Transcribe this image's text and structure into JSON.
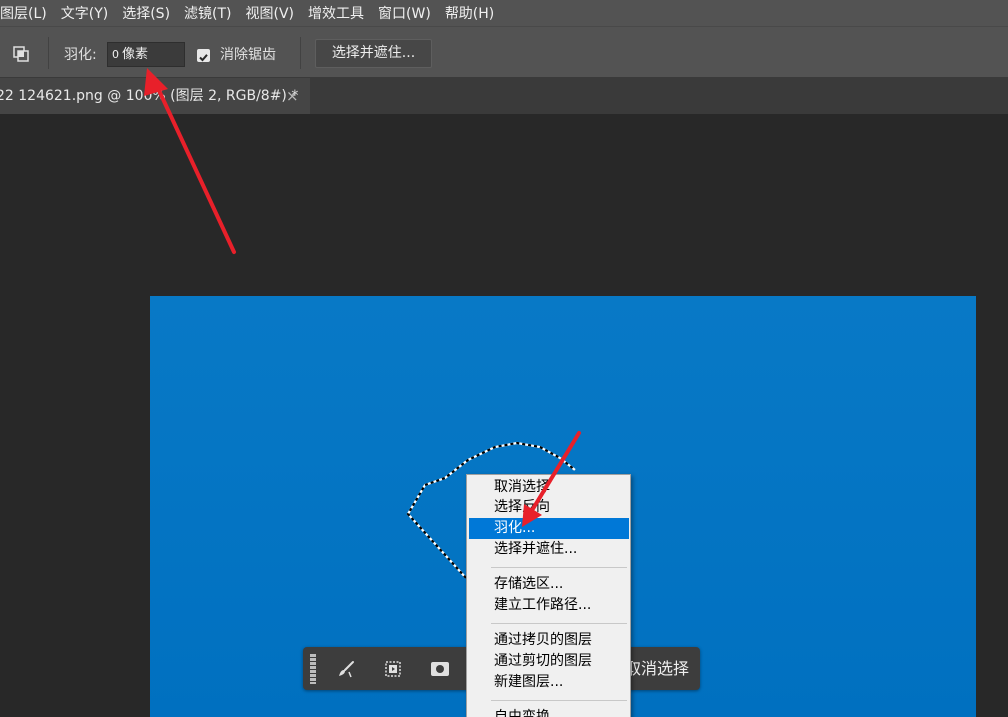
{
  "menubar": {
    "items": [
      "图层(L)",
      "文字(Y)",
      "选择(S)",
      "滤镜(T)",
      "视图(V)",
      "增效工具",
      "窗口(W)",
      "帮助(H)"
    ]
  },
  "options": {
    "feather_label": "羽化:",
    "feather_value": "0",
    "feather_unit": "像素",
    "antialias_label": "消除锯齿",
    "antialias_checked": true,
    "refine_button": "选择并遮住..."
  },
  "document_tab": {
    "title": "22 124621.png @ 100% (图层 2, RGB/8#) *",
    "close": "×"
  },
  "colors": {
    "canvas_fill": "#0070c0",
    "arrow": "#e8202a",
    "menu_highlight": "#0078d7"
  },
  "context_menu": {
    "items": [
      {
        "label": "取消选择",
        "highlighted": false
      },
      {
        "label": "选择反向",
        "highlighted": false
      },
      {
        "label": "羽化...",
        "highlighted": true
      },
      {
        "label": "选择并遮住...",
        "highlighted": false
      },
      {
        "label": "存储选区...",
        "highlighted": false
      },
      {
        "label": "建立工作路径...",
        "highlighted": false
      },
      {
        "label": "通过拷贝的图层",
        "highlighted": false
      },
      {
        "label": "通过剪切的图层",
        "highlighted": false
      },
      {
        "label": "新建图层...",
        "highlighted": false
      },
      {
        "label": "自由变换",
        "highlighted": false
      }
    ]
  },
  "taskbar": {
    "icons": [
      "grip-handle-icon",
      "brush-icon",
      "transform-selection-icon",
      "mask-icon"
    ],
    "deselect_label": "取消选择"
  }
}
